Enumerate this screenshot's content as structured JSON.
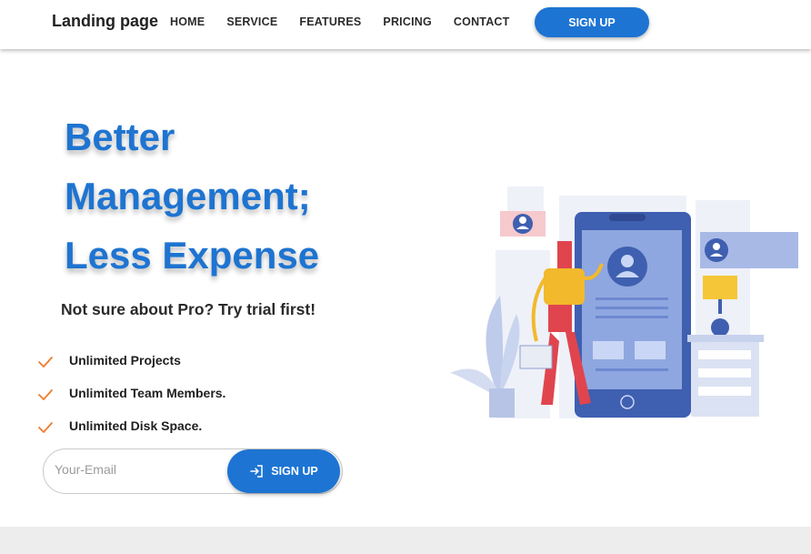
{
  "nav": {
    "brand": "Landing page",
    "links": [
      "HOME",
      "SERVICE",
      "FEATURES",
      "PRICING",
      "CONTACT"
    ],
    "signup_label": "SIGN UP"
  },
  "hero": {
    "title_lines": [
      "Better",
      "Management;",
      "Less Expense"
    ],
    "subtitle": "Not sure about Pro? Try trial first!",
    "features": [
      "Unlimited Projects",
      "Unlimited Team Members.",
      "Unlimited Disk Space."
    ],
    "email_placeholder": "Your-Email",
    "form_signup_label": "SIGN UP"
  },
  "colors": {
    "accent": "#1d74d3",
    "check": "#f07c2c",
    "footer_band": "#ededed"
  }
}
